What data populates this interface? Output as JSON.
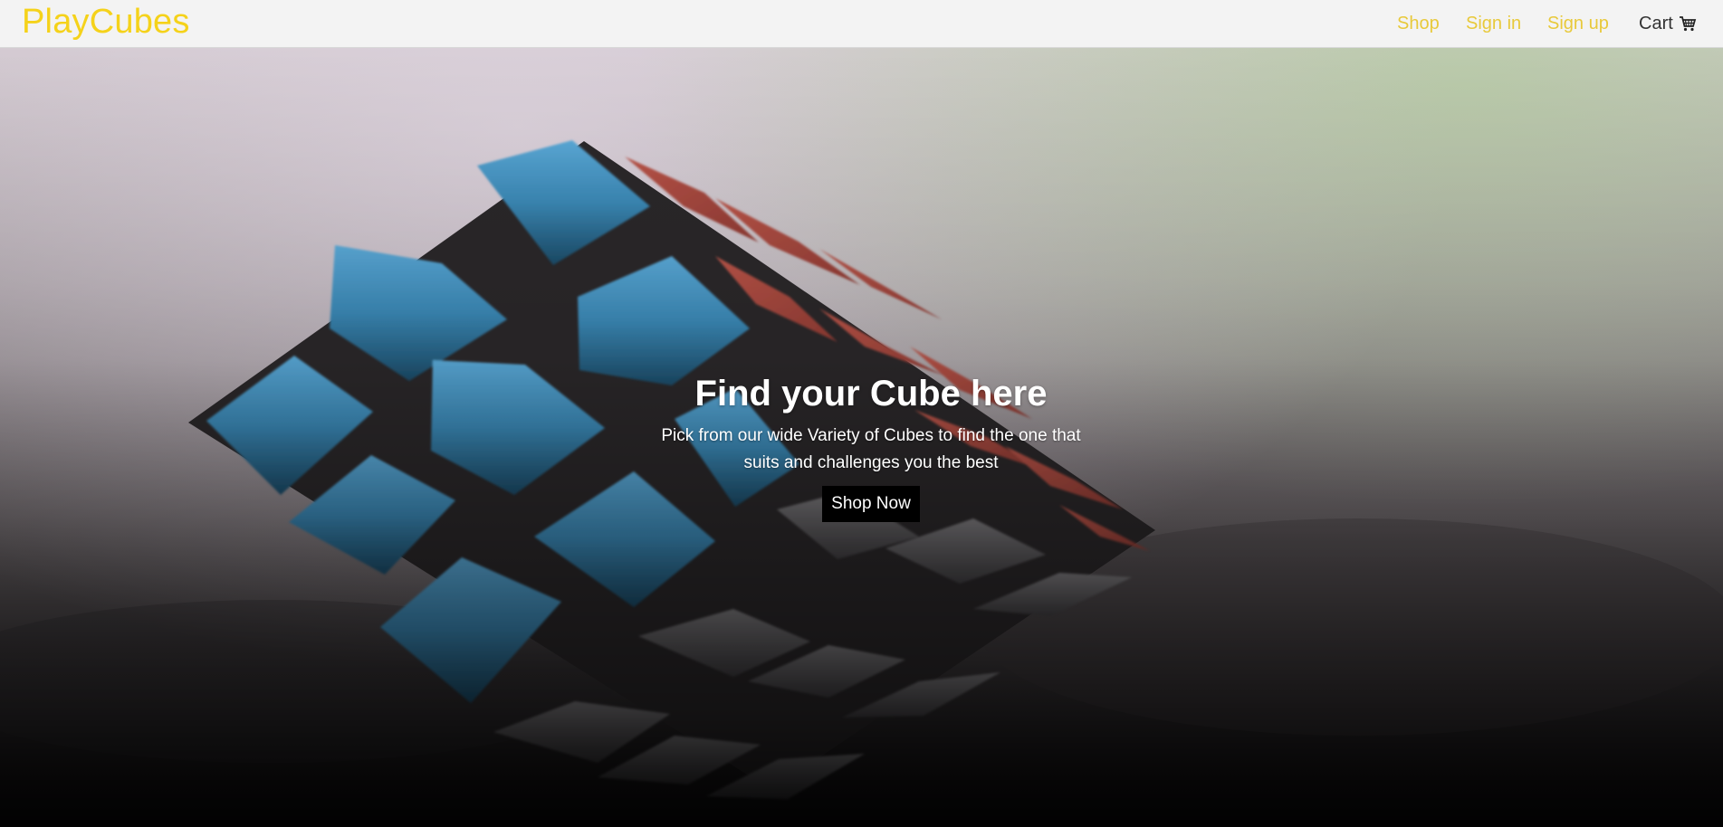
{
  "brand": {
    "name": "PlayCubes"
  },
  "nav": {
    "shop": "Shop",
    "sign_in": "Sign in",
    "sign_up": "Sign up",
    "cart": "Cart",
    "cart_icon": "cart-icon"
  },
  "hero": {
    "title": "Find your Cube here",
    "subtitle": "Pick from our wide Variety of Cubes to find the one that suits and challenges you the best",
    "cta": "Shop Now",
    "image_desc_icon": "rubiks-cube-photo"
  },
  "colors": {
    "brand": "#f5d21a",
    "nav_link": "#e8c93a",
    "navbar_bg": "#f3f3f3",
    "cta_bg": "#000000",
    "cube_blue": "#3b8fc0",
    "cube_red": "#b5463b",
    "cube_white": "#6b6a6b"
  }
}
